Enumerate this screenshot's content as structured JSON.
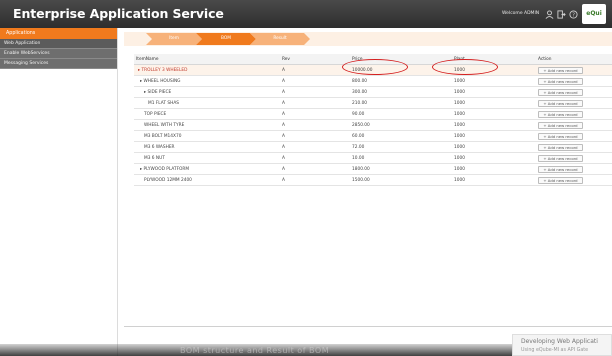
{
  "header": {
    "title": "Enterprise Application Service",
    "welcome": "Welcome ADMIN",
    "logo_text": "eQui",
    "icons": [
      "user-icon",
      "logout-icon",
      "help-icon"
    ]
  },
  "sidebar": {
    "section_title": "Applications",
    "items": [
      {
        "label": "Web Application",
        "active": true
      },
      {
        "label": "Enable WebServices",
        "active": false
      },
      {
        "label": "Messaging Services",
        "active": false
      }
    ]
  },
  "steps": [
    {
      "label": "Item"
    },
    {
      "label": "BOM"
    },
    {
      "label": "Result"
    }
  ],
  "table": {
    "headers": {
      "name": "ItemName",
      "rev": "Rev",
      "price": "Price",
      "plant": "Plant",
      "action": "Action"
    },
    "rows": [
      {
        "name": "▸ TROLLEY 3 WHEELED",
        "rev": "A",
        "price": "10000.00",
        "plant": "1000",
        "action": "+ Add new record"
      },
      {
        "name": "▸ WHEEL HOUSING",
        "rev": "A",
        "price": "800.00",
        "plant": "1000",
        "action": "+ Add new record"
      },
      {
        "name": "▸ SIDE PIECE",
        "rev": "A",
        "price": "300.00",
        "plant": "1000",
        "action": "+ Add new record"
      },
      {
        "name": "M1 FLAT SHAS",
        "rev": "A",
        "price": "210.00",
        "plant": "1000",
        "action": "+ Add new record"
      },
      {
        "name": "TOP PIECE",
        "rev": "A",
        "price": "90.00",
        "plant": "1000",
        "action": "+ Add new record"
      },
      {
        "name": "WHEEL WITH TYRE",
        "rev": "A",
        "price": "2850.00",
        "plant": "1000",
        "action": "+ Add new record"
      },
      {
        "name": "M3 BOLT M14X70",
        "rev": "A",
        "price": "60.00",
        "plant": "1000",
        "action": "+ Add new record"
      },
      {
        "name": "M3 6 WASHER",
        "rev": "A",
        "price": "72.00",
        "plant": "1000",
        "action": "+ Add new record"
      },
      {
        "name": "M3 6 NUT",
        "rev": "A",
        "price": "10.00",
        "plant": "1000",
        "action": "+ Add new record"
      },
      {
        "name": "▸ PLYWOOD PLATFORM",
        "rev": "A",
        "price": "1800.00",
        "plant": "1000",
        "action": "+ Add new record"
      },
      {
        "name": "PLYWOOD 12MM 2400",
        "rev": "A",
        "price": "1500.00",
        "plant": "1000",
        "action": "+ Add new record"
      }
    ]
  },
  "toast": {
    "line1": "Developing Web Applicati",
    "line2": "Using eQube-MI as API Gate"
  },
  "video_caption": "BOM structure and Result of BOM",
  "colors": {
    "accent": "#f07a1d",
    "header": "#3a3a3a",
    "highlight": "#d42020"
  }
}
